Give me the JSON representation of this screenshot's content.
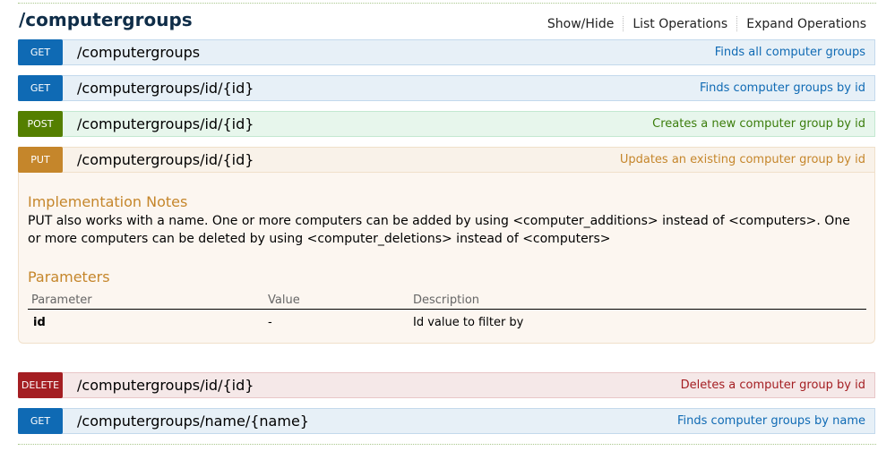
{
  "resource": {
    "title": "/computergroups",
    "links": [
      "Show/Hide",
      "List Operations",
      "Expand Operations"
    ]
  },
  "operations": [
    {
      "method": "GET",
      "path": "/computergroups",
      "summary": "Finds all computer groups"
    },
    {
      "method": "GET",
      "path": "/computergroups/id/{id}",
      "summary": "Finds computer groups by id"
    },
    {
      "method": "POST",
      "path": "/computergroups/id/{id}",
      "summary": "Creates a new computer group by id"
    },
    {
      "method": "PUT",
      "path": "/computergroups/id/{id}",
      "summary": "Updates an existing computer group by id"
    },
    {
      "method": "DELETE",
      "path": "/computergroups/id/{id}",
      "summary": "Deletes a computer group by id"
    },
    {
      "method": "GET",
      "path": "/computergroups/name/{name}",
      "summary": "Finds computer groups by name"
    }
  ],
  "expanded": {
    "notes_heading": "Implementation Notes",
    "notes": "PUT also works with a name. One or more computers can be added by using <computer_additions> instead of <computers>. One or more computers can be deleted by using <computer_deletions> instead of <computers>",
    "params_heading": "Parameters",
    "columns": [
      "Parameter",
      "Value",
      "Description"
    ],
    "params": [
      {
        "name": "id",
        "value": "-",
        "description": "Id value to filter by"
      }
    ]
  },
  "colors": {
    "get": "#0f6ab4",
    "post": "#547f00",
    "put": "#c5862b",
    "delete": "#a41e22"
  }
}
